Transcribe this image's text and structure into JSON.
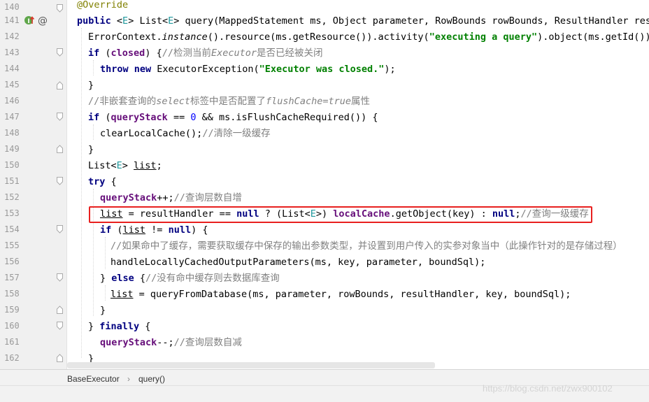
{
  "editor": {
    "line_numbers": [
      "140",
      "141",
      "142",
      "143",
      "144",
      "145",
      "146",
      "147",
      "148",
      "149",
      "150",
      "151",
      "152",
      "153",
      "154",
      "155",
      "156",
      "157",
      "158",
      "159",
      "160",
      "161",
      "162"
    ]
  },
  "breadcrumb": {
    "class_name": "BaseExecutor",
    "separator": "›",
    "method_name": "query()"
  },
  "watermark": "https://blog.csdn.net/zwx900102",
  "colors": {
    "highlight_box": "#e8201f",
    "keyword": "#000080",
    "field": "#660e7a",
    "string": "#008000",
    "comment": "#808080",
    "annotation": "#808000",
    "type_param": "#20999d"
  },
  "gutter_icons": [
    "implements-method-icon",
    "override-annotation-icon"
  ]
}
